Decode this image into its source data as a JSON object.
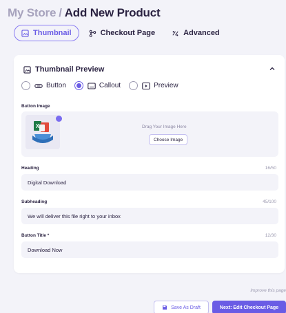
{
  "header": {
    "store": "My Store",
    "separator": "/",
    "page_title": "Add New Product"
  },
  "tabs": [
    {
      "label": "Thumbnail",
      "icon": "image-icon",
      "active": true
    },
    {
      "label": "Checkout Page",
      "icon": "branch-icon",
      "active": false
    },
    {
      "label": "Advanced",
      "icon": "sliders-icon",
      "active": false
    }
  ],
  "thumbnail_card": {
    "title": "Thumbnail Preview",
    "icon": "image-icon",
    "radio_options": [
      {
        "label": "Button",
        "icon": "button-icon",
        "selected": false
      },
      {
        "label": "Callout",
        "icon": "callout-icon",
        "selected": true
      },
      {
        "label": "Preview",
        "icon": "play-icon",
        "selected": false
      }
    ],
    "button_image": {
      "label": "Button Image",
      "drag_text": "Drag Your Image Here",
      "choose_label": "Choose Image"
    },
    "heading": {
      "label": "Heading",
      "counter": "16/50",
      "value": "Digital Download"
    },
    "subheading": {
      "label": "Subheading",
      "counter": "45/100",
      "value": "We will deliver this file right to your inbox"
    },
    "button_title": {
      "label": "Button Title *",
      "counter": "12/30",
      "value": "Download Now"
    }
  },
  "footer": {
    "improve_text": "Improve this page",
    "draft_label": "Save As Draft",
    "next_label": "Next: Edit Checkout Page"
  },
  "colors": {
    "accent": "#6a5ce5",
    "background": "#f3f3f9"
  }
}
